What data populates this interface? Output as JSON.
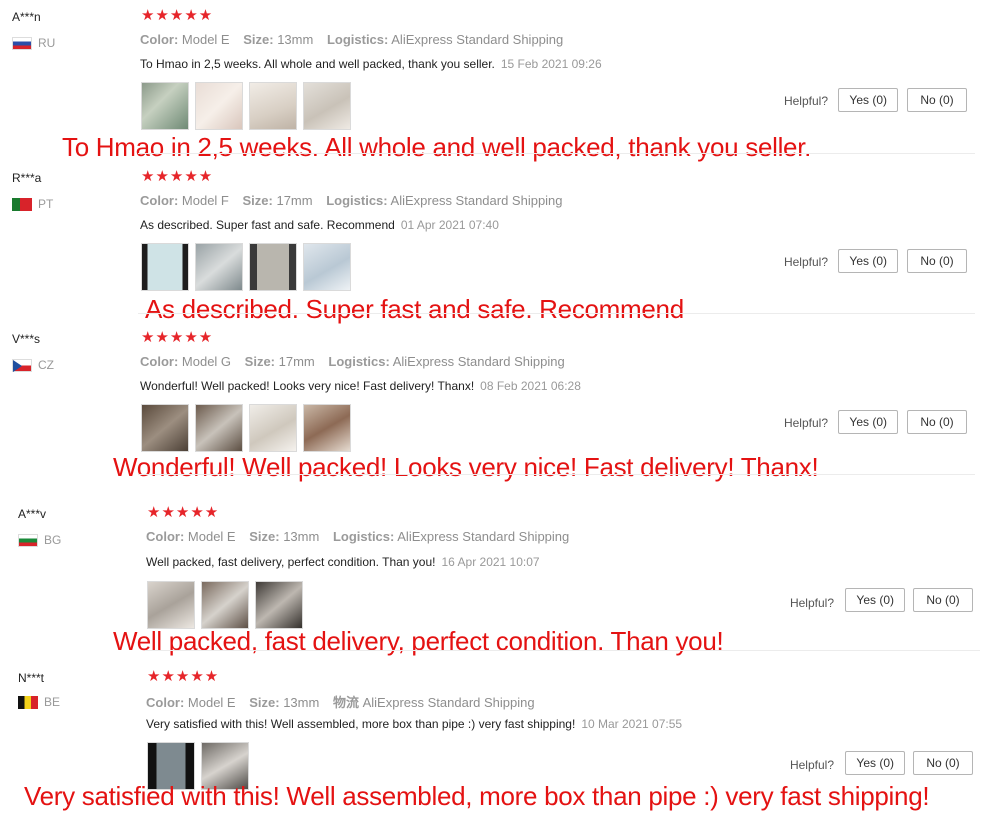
{
  "reviews": [
    {
      "user": "A***n",
      "country": "RU",
      "stars": "★★★★★",
      "color_label": "Color:",
      "color": "Model E",
      "size_label": "Size:",
      "size": "13mm",
      "logistics_label": "Logistics:",
      "logistics": "AliExpress Standard Shipping",
      "text": "To Hmao in 2,5 weeks. All whole and well packed, thank you seller.",
      "date": "15 Feb 2021 09:26",
      "helpful": "Helpful?",
      "yes": "Yes (0)",
      "no": "No (0)",
      "overlay": "To Hmao in 2,5 weeks. All whole and well packed, thank you seller."
    },
    {
      "user": "R***a",
      "country": "PT",
      "stars": "★★★★★",
      "color_label": "Color:",
      "color": "Model F",
      "size_label": "Size:",
      "size": "17mm",
      "logistics_label": "Logistics:",
      "logistics": "AliExpress Standard Shipping",
      "text": "As described. Super fast and safe. Recommend",
      "date": "01 Apr 2021 07:40",
      "helpful": "Helpful?",
      "yes": "Yes (0)",
      "no": "No (0)",
      "overlay": "As described. Super fast and safe. Recommend"
    },
    {
      "user": "V***s",
      "country": "CZ",
      "stars": "★★★★★",
      "color_label": "Color:",
      "color": "Model G",
      "size_label": "Size:",
      "size": "17mm",
      "logistics_label": "Logistics:",
      "logistics": "AliExpress Standard Shipping",
      "text": "Wonderful! Well packed! Looks very nice! Fast delivery! Thanx!",
      "date": "08 Feb 2021 06:28",
      "helpful": "Helpful?",
      "yes": "Yes (0)",
      "no": "No (0)",
      "overlay": "Wonderful! Well packed! Looks very nice! Fast delivery! Thanx!"
    },
    {
      "user": "A***v",
      "country": "BG",
      "stars": "★★★★★",
      "color_label": "Color:",
      "color": "Model E",
      "size_label": "Size:",
      "size": "13mm",
      "logistics_label": "Logistics:",
      "logistics": "AliExpress Standard Shipping",
      "text": "Well packed, fast delivery, perfect condition. Than you!",
      "date": "16 Apr 2021 10:07",
      "helpful": "Helpful?",
      "yes": "Yes (0)",
      "no": "No (0)",
      "overlay": "Well packed, fast delivery, perfect condition. Than you!"
    },
    {
      "user": "N***t",
      "country": "BE",
      "stars": "★★★★★",
      "color_label": "Color:",
      "color": "Model E",
      "size_label": "Size:",
      "size": "13mm",
      "logistics_label": "物流",
      "logistics": "AliExpress Standard Shipping",
      "text": "Very satisfied with this! Well assembled, more box than pipe :) very fast shipping!",
      "date": "10 Mar 2021 07:55",
      "helpful": "Helpful?",
      "yes": "Yes (0)",
      "no": "No (0)",
      "overlay": "Very satisfied with this! Well assembled, more box than pipe :) very fast shipping!"
    }
  ],
  "colors": {
    "star": "#e6252a",
    "overlay": "#e41212"
  }
}
